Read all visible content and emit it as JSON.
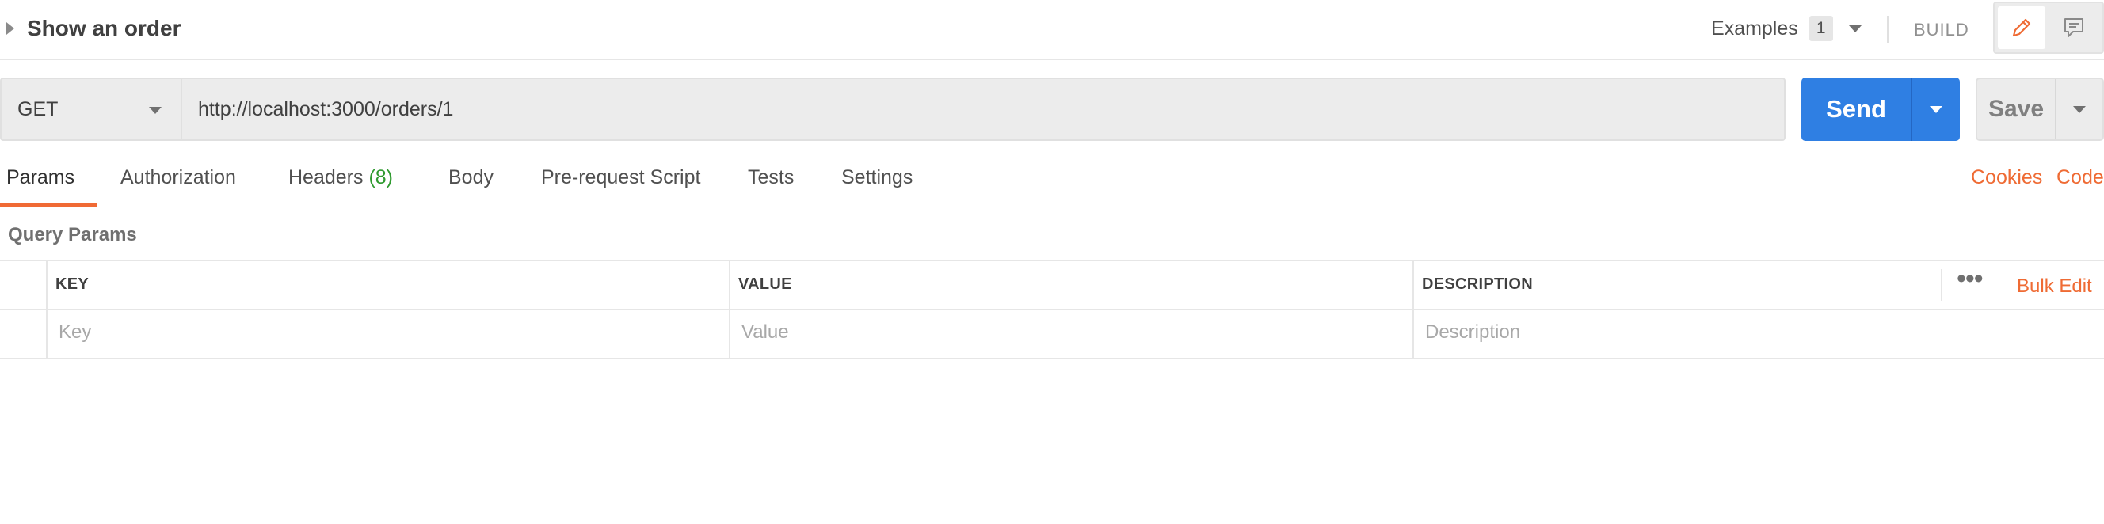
{
  "header": {
    "title": "Show an order",
    "examples_label": "Examples",
    "examples_count": "1",
    "build_label": "BUILD"
  },
  "request": {
    "method": "GET",
    "url": "http://localhost:3000/orders/1",
    "send_label": "Send",
    "save_label": "Save"
  },
  "tabs": [
    {
      "label": "Params"
    },
    {
      "label": "Authorization"
    },
    {
      "label": "Headers",
      "count": "(8)"
    },
    {
      "label": "Body"
    },
    {
      "label": "Pre-request Script"
    },
    {
      "label": "Tests"
    },
    {
      "label": "Settings"
    }
  ],
  "links": {
    "cookies": "Cookies",
    "code": "Code"
  },
  "params": {
    "section_label": "Query Params",
    "columns": [
      "KEY",
      "VALUE",
      "DESCRIPTION"
    ],
    "placeholders": {
      "key": "Key",
      "value": "Value",
      "description": "Description"
    },
    "more_label": "•••",
    "bulk_edit_label": "Bulk Edit"
  },
  "colors": {
    "accent": "#ef6b34",
    "primary": "#2f7fe3",
    "count_green": "#2f9a2f"
  }
}
